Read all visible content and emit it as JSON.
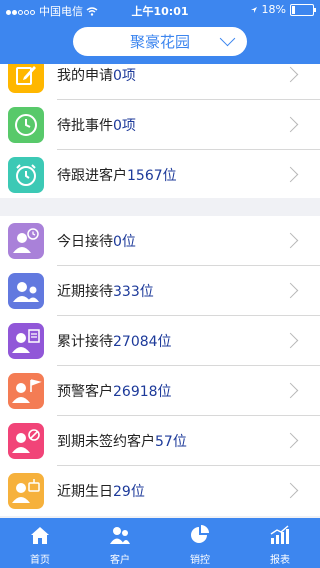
{
  "status_bar": {
    "carrier": "中国电信",
    "time": "上午10:01",
    "battery": "18%"
  },
  "header": {
    "project_name": "聚豪花园"
  },
  "groups": [
    {
      "items": [
        {
          "label": "我的申请",
          "count": "0项",
          "icon": "edit-icon",
          "color": "#ffb700"
        },
        {
          "label": "待批事件",
          "count": "0项",
          "icon": "clock-icon",
          "color": "#58c96a"
        },
        {
          "label": "待跟进客户",
          "count": "1567位",
          "icon": "alarm-clock-icon",
          "color": "#3cc9b5"
        }
      ]
    },
    {
      "items": [
        {
          "label": "今日接待",
          "count": "0位",
          "icon": "user-clock-icon",
          "color": "#a981d9"
        },
        {
          "label": "近期接待",
          "count": "333位",
          "icon": "users-icon",
          "color": "#6279df"
        },
        {
          "label": "累计接待",
          "count": "27084位",
          "icon": "user-list-icon",
          "color": "#9157d8"
        },
        {
          "label": "预警客户",
          "count": "26918位",
          "icon": "user-flag-icon",
          "color": "#f47c54"
        },
        {
          "label": "到期未签约客户",
          "count": "57位",
          "icon": "user-no-icon",
          "color": "#f14478"
        },
        {
          "label": "近期生日",
          "count": "29位",
          "icon": "user-cake-icon",
          "color": "#f6b13c"
        }
      ]
    }
  ],
  "tabbar": [
    {
      "label": "首页",
      "icon": "home-icon"
    },
    {
      "label": "客户",
      "icon": "customers-icon"
    },
    {
      "label": "销控",
      "icon": "pie-chart-icon"
    },
    {
      "label": "报表",
      "icon": "bar-chart-icon"
    }
  ],
  "colors": {
    "primary": "#3d86ef",
    "count_text": "#1d3a9a"
  }
}
